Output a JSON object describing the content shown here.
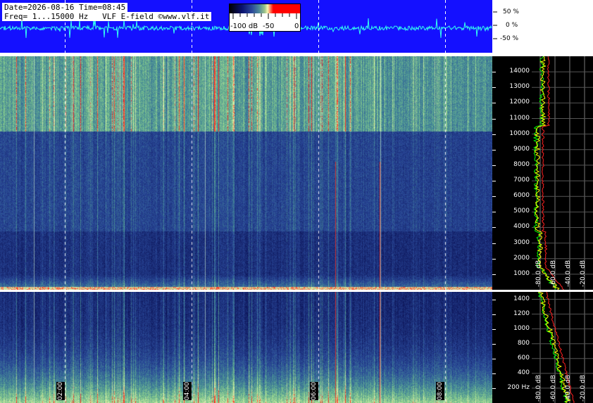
{
  "header": {
    "line1": "Date=2026-08-16 Time=08:45",
    "line2": "Freq= 1...15000 Hz   VLF E-field ©www.vlf.it"
  },
  "colorbar": {
    "min_label": "-100 dB",
    "mid_label": "-50",
    "max_label": "0"
  },
  "waveform_axis": {
    "labels": [
      "50 %",
      "0 %",
      "-50 %"
    ]
  },
  "chart_data": [
    {
      "type": "heatmap",
      "name_hint": "spectrogram-top",
      "ylim": [
        0,
        15000
      ],
      "y_ticks": [
        "1000",
        "2000",
        "3000",
        "4000",
        "5000",
        "6000",
        "7000",
        "8000",
        "9000",
        "10000",
        "11000",
        "12000",
        "13000",
        "14000"
      ]
    },
    {
      "type": "heatmap",
      "name_hint": "spectrogram-bottom",
      "ylim": [
        0,
        1500
      ],
      "y_ticks": [
        "200 Hz",
        "400",
        "600",
        "800",
        "1000",
        "1200",
        "1400"
      ]
    },
    {
      "type": "line",
      "name_hint": "spectrum-profile",
      "x_ticks": [
        "-80.0 dB",
        "-60.0 dB",
        "-40.0 dB",
        "-20.0 dB"
      ]
    }
  ],
  "time_axis": {
    "labels": [
      "02:00",
      "04:00",
      "06:00",
      "08:00"
    ]
  },
  "colors": {
    "wave_bg": "#1410ff",
    "wave_line": "#33ffee",
    "profile_yellow": "#ffff00",
    "profile_green": "#00ff00",
    "profile_red": "#ff2020"
  }
}
